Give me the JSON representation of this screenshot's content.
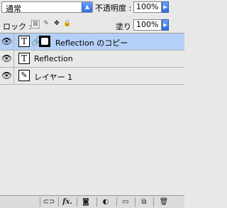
{
  "blend": {
    "mode": "通常"
  },
  "opacity": {
    "label": "不透明度 :",
    "value": "100%"
  },
  "lock": {
    "label": "ロック :"
  },
  "fill": {
    "label": "塗り :",
    "value": "100%"
  },
  "layers": [
    {
      "name": "Reflection のコピー",
      "type": "text",
      "selected": true,
      "has_mask": true
    },
    {
      "name": "Reflection",
      "type": "text",
      "selected": false,
      "has_mask": false
    },
    {
      "name": "レイヤー 1",
      "type": "brush",
      "selected": false,
      "has_mask": false
    }
  ],
  "icons": {
    "eye": "eye-icon",
    "text": "T",
    "link": "link-icon",
    "mask": "layer-mask-icon",
    "brush": "brush-icon",
    "lock_transparent": "lock-transparent-icon",
    "lock_paint": "lock-paint-icon",
    "lock_move": "lock-move-icon",
    "lock_all": "lock-all-icon"
  },
  "bottom_bar": {
    "fx_label": "fx."
  },
  "colors": {
    "selected_row": "#b5d0f6",
    "accent": "#2f6fe0"
  }
}
